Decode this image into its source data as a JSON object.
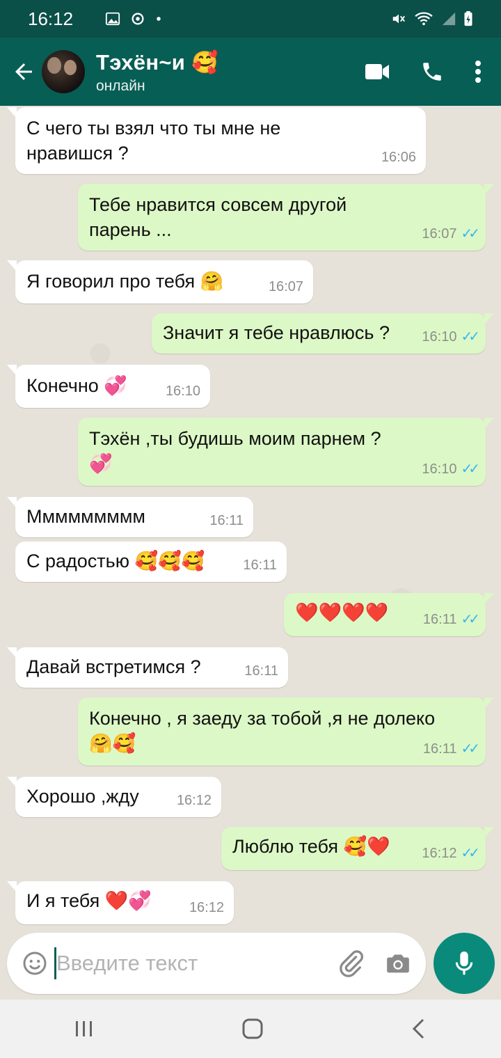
{
  "status_bar": {
    "time": "16:12"
  },
  "header": {
    "contact_name": "Тэхён~и 🥰",
    "contact_status": "онлайн"
  },
  "messages": [
    {
      "dir": "in",
      "lines": [
        "С чего ты взял что ты мне не",
        "нравишся ?"
      ],
      "time": "16:06",
      "read": false
    },
    {
      "dir": "out",
      "lines": [
        "Тебе нравится совсем другой",
        "парень ..."
      ],
      "time": "16:07",
      "read": true
    },
    {
      "dir": "in",
      "lines": [
        "Я говорил про тебя 🤗"
      ],
      "time": "16:07",
      "read": false
    },
    {
      "dir": "out",
      "lines": [
        "Значит я тебе нравлюсь ?"
      ],
      "time": "16:10",
      "read": true
    },
    {
      "dir": "in",
      "lines": [
        "Конечно 💞"
      ],
      "time": "16:10",
      "read": false
    },
    {
      "dir": "out",
      "lines": [
        "Тэхён ,ты будишь моим парнем ?",
        "💞"
      ],
      "time": "16:10",
      "read": true
    },
    {
      "dir": "in",
      "lines": [
        "Ммммммммм"
      ],
      "time": "16:11",
      "read": false
    },
    {
      "dir": "in",
      "lines": [
        "С радостью 🥰🥰🥰"
      ],
      "time": "16:11",
      "read": false
    },
    {
      "dir": "out",
      "lines": [
        "❤️❤️❤️❤️"
      ],
      "time": "16:11",
      "read": true
    },
    {
      "dir": "in",
      "lines": [
        "Давай встретимся ?"
      ],
      "time": "16:11",
      "read": false
    },
    {
      "dir": "out",
      "lines": [
        "Конечно , я заеду за тобой ,я не долеко",
        "🤗🥰"
      ],
      "time": "16:11",
      "read": true
    },
    {
      "dir": "in",
      "lines": [
        "Хорошо ,жду"
      ],
      "time": "16:12",
      "read": false
    },
    {
      "dir": "out",
      "lines": [
        "Люблю тебя 🥰❤️"
      ],
      "time": "16:12",
      "read": true
    },
    {
      "dir": "in",
      "lines": [
        "И я тебя ❤️💞"
      ],
      "time": "16:12",
      "read": false
    }
  ],
  "composer": {
    "placeholder": "Введите текст"
  },
  "icons": {
    "back": "arrow-left-icon",
    "video": "video-call-icon",
    "call": "phone-icon",
    "menu": "more-vert-icon",
    "emoji": "emoji-icon",
    "attach": "paperclip-icon",
    "camera": "camera-icon",
    "mic": "mic-icon"
  },
  "colors": {
    "header": "#075e54",
    "status_bar": "#0b4f49",
    "incoming": "#ffffff",
    "outgoing": "#dcf8c6",
    "read_ticks": "#34b7f1",
    "mic_button": "#0a8a7b"
  }
}
